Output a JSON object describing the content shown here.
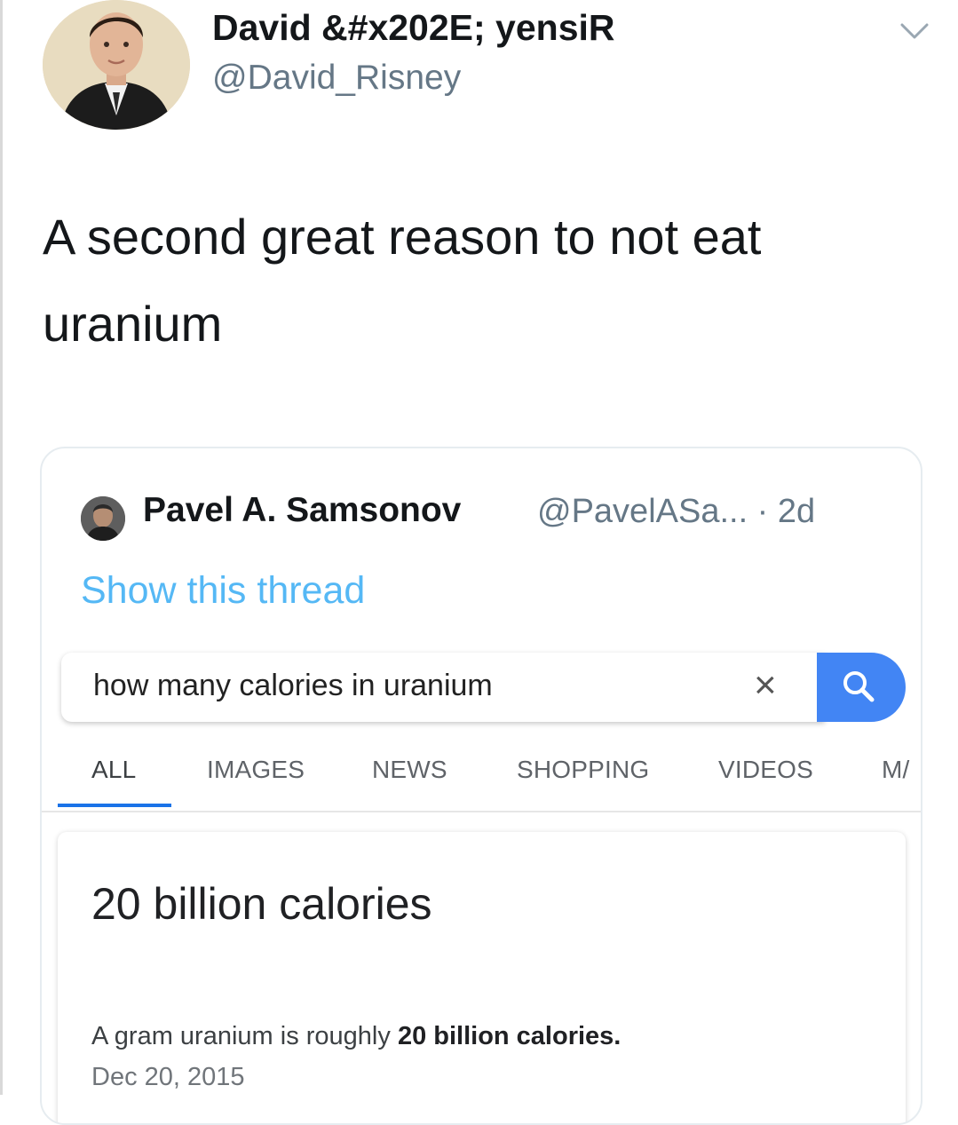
{
  "tweet": {
    "display_name": "David &#x202E; yensiR",
    "handle": "@David_Risney",
    "text": "A second great reason to not eat uranium"
  },
  "quoted_tweet": {
    "author_name": "Pavel A. Samsonov",
    "meta": "@PavelASa... · 2d",
    "show_thread": "Show this thread",
    "search": {
      "query": "how many calories in uranium",
      "clear_symbol": "×"
    },
    "tabs": [
      {
        "label": "ALL",
        "active": true
      },
      {
        "label": "IMAGES",
        "active": false
      },
      {
        "label": "NEWS",
        "active": false
      },
      {
        "label": "SHOPPING",
        "active": false
      },
      {
        "label": "VIDEOS",
        "active": false
      },
      {
        "label": "M/",
        "active": false
      }
    ],
    "result": {
      "answer": "20 billion calories",
      "snippet_prefix": "A gram uranium is roughly ",
      "snippet_bold": "20 billion calories.",
      "date": "Dec 20, 2015"
    }
  },
  "colors": {
    "link": "#1da1f2",
    "search_button": "#4285f4",
    "active_tab_underline": "#1a73e8"
  },
  "icons": [
    "avatar-photo",
    "chevron-down-icon",
    "close-icon",
    "search-icon"
  ]
}
